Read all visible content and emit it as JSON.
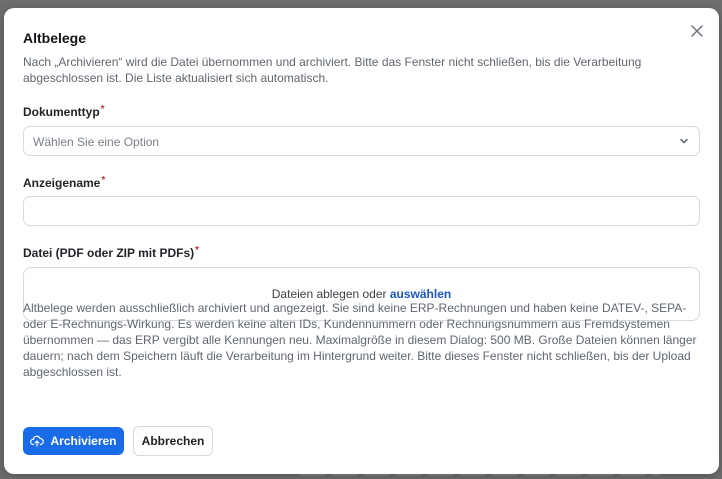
{
  "dialog": {
    "title": "Altbelege",
    "intro": "Nach „Archivieren“ wird die Datei übernommen und archiviert. Bitte das Fenster nicht schließen, bis die Verarbeitung abgeschlossen ist. Die Liste aktualisiert sich automatisch."
  },
  "fields": {
    "document_type": {
      "label": "Dokumenttyp",
      "required_marker": "*",
      "placeholder": "Wählen Sie eine Option",
      "value": ""
    },
    "display_name": {
      "label": "Anzeigename",
      "required_marker": "*",
      "value": ""
    },
    "file": {
      "label": "Datei (PDF oder ZIP mit PDFs)",
      "required_marker": "*",
      "drop_text": "Dateien ablegen oder",
      "browse_link": "auswählen"
    }
  },
  "help_text": "Altbelege werden ausschließlich archiviert und angezeigt. Sie sind keine ERP-Rechnungen und haben keine DATEV-, SEPA- oder E-Rechnungs-Wirkung. Es werden keine alten IDs, Kundennummern oder Rechnungsnummern aus Fremdsystemen übernommen — das ERP vergibt alle Kennungen neu. Maximalgröße in diesem Dialog: 500 MB. Große Dateien können länger dauern; nach dem Speichern läuft die Verarbeitung im Hintergrund weiter. Bitte dieses Fenster nicht schließen, bis der Upload abgeschlossen ist.",
  "actions": {
    "archive_label": "Archivieren",
    "cancel_label": "Abbrechen"
  },
  "icons": {
    "close": "close-icon",
    "chevron": "chevron-down-icon",
    "upload": "cloud-upload-icon"
  },
  "colors": {
    "primary": "#1a6be8",
    "link": "#1a56c7",
    "required": "#d12f2f"
  }
}
